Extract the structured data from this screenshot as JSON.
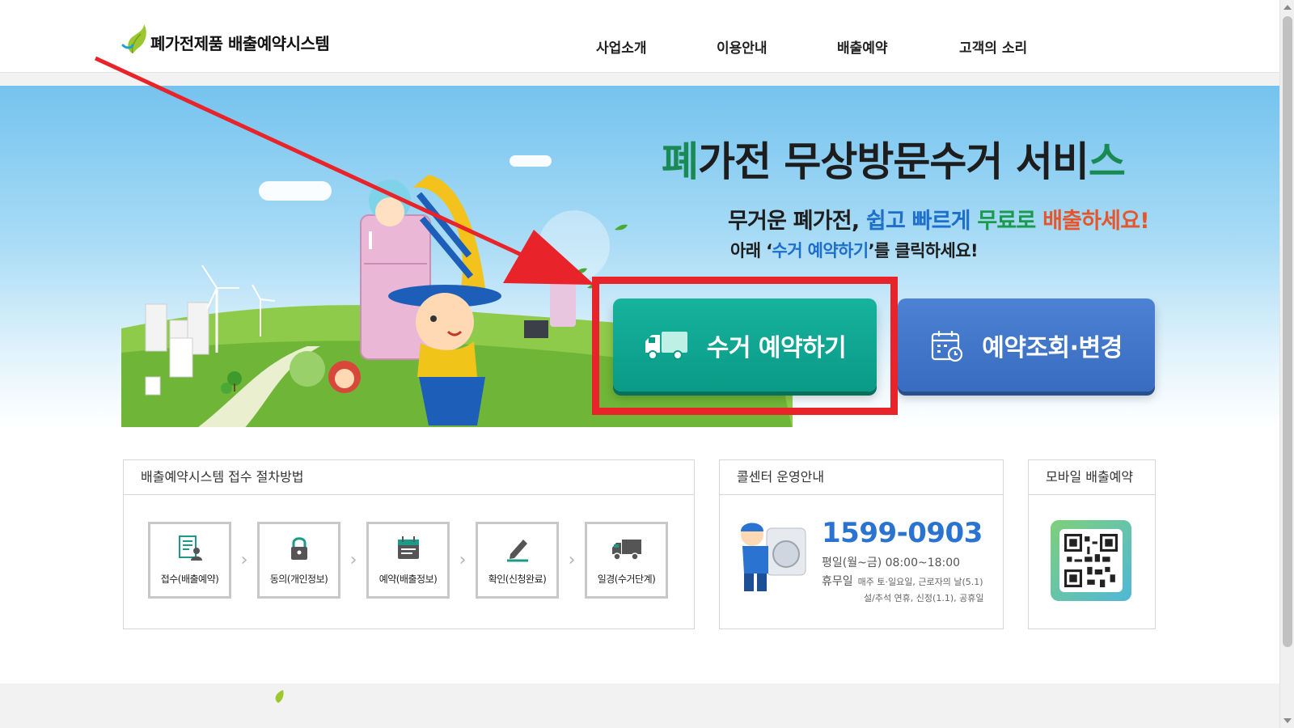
{
  "header": {
    "logo_text": "폐가전제품 배출예약시스템",
    "nav": [
      {
        "label": "사업소개"
      },
      {
        "label": "이용안내"
      },
      {
        "label": "배출예약"
      },
      {
        "label": "고객의 소리"
      }
    ]
  },
  "hero": {
    "title_first": "폐",
    "title_middle": "가전 무상방문수거 서비",
    "title_last": "스",
    "sub1_a": "무거운 폐가전, ",
    "sub1_b": "쉽고 빠르게",
    "sub1_c": " ",
    "sub1_d": "무료로",
    "sub1_e": " ",
    "sub1_f": "배출하세요!",
    "sub2_a": "아래 ‘",
    "sub2_b": "수거 예약하기",
    "sub2_c": "’를 클릭하세요!",
    "reserve_button": "수거 예약하기",
    "check_button": "예약조회·변경"
  },
  "procedure": {
    "title": "배출예약시스템 접수 절차방법",
    "steps": [
      {
        "label": "접수(배출예약)",
        "icon": "document-person-icon"
      },
      {
        "label": "동의(개인정보)",
        "icon": "lock-icon"
      },
      {
        "label": "예약(배출정보)",
        "icon": "calendar-note-icon"
      },
      {
        "label": "확인(신청완료)",
        "icon": "pencil-icon"
      },
      {
        "label": "일경(수거단계)",
        "icon": "truck-icon"
      }
    ]
  },
  "callcenter": {
    "title": "콜센터 운영안내",
    "phone": "1599-0903",
    "hours": "평일(월~금)  08:00~18:00",
    "holiday_label": "휴무일",
    "holiday_detail": "매주 토·일요일, 근로자의 날(5.1)",
    "holiday_detail2": "설/추석 연휴, 신정(1.1), 공휴일"
  },
  "mobile": {
    "title": "모바일 배출예약"
  },
  "colors": {
    "reserve": "#0fa892",
    "check": "#4378c9",
    "highlight": "#e8232a",
    "phone": "#2b73d0"
  }
}
